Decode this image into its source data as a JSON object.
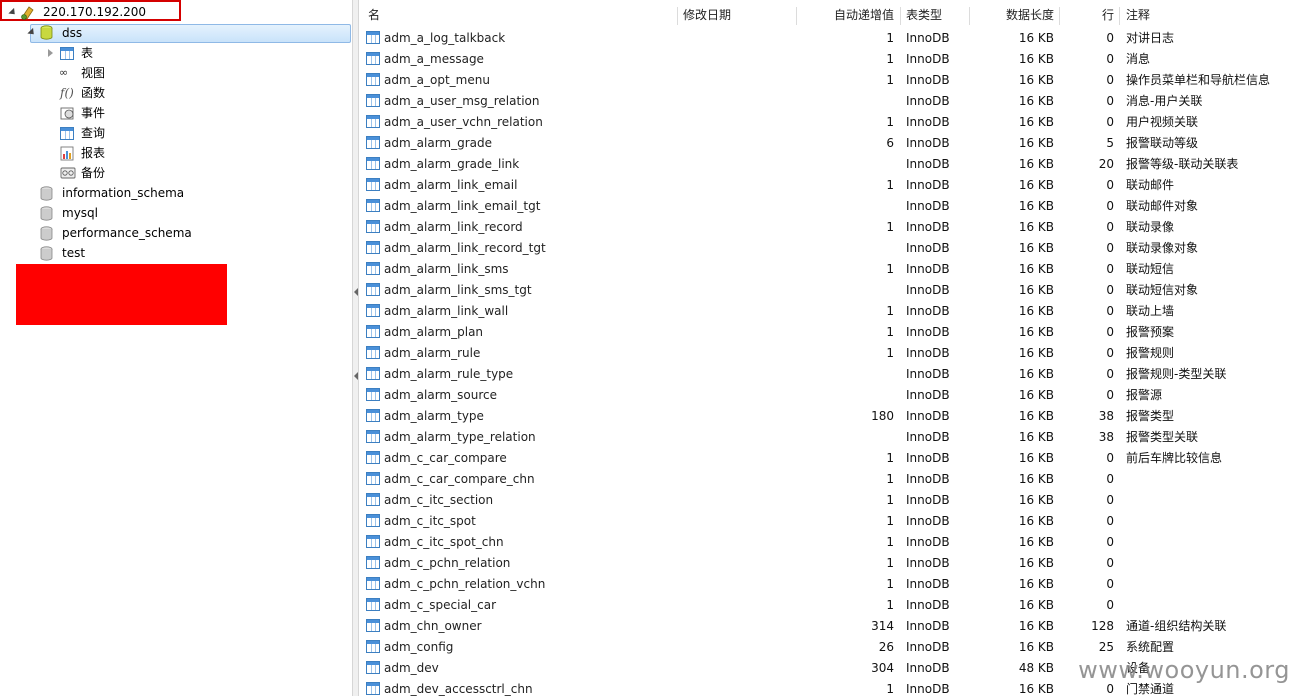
{
  "tree": {
    "connection": "220.170.192.200",
    "database": "dss",
    "children": [
      "表",
      "视图",
      "函数",
      "事件",
      "查询",
      "报表",
      "备份"
    ],
    "other_databases": [
      "information_schema",
      "mysql",
      "performance_schema",
      "test"
    ]
  },
  "columns": [
    "名",
    "修改日期",
    "自动递增值",
    "表类型",
    "数据长度",
    "行",
    "注释"
  ],
  "rows": [
    {
      "name": "adm_a_log_talkback",
      "auto": "1",
      "type": "InnoDB",
      "len": "16 KB",
      "rows": "0",
      "comment": "对讲日志"
    },
    {
      "name": "adm_a_message",
      "auto": "1",
      "type": "InnoDB",
      "len": "16 KB",
      "rows": "0",
      "comment": "消息"
    },
    {
      "name": "adm_a_opt_menu",
      "auto": "1",
      "type": "InnoDB",
      "len": "16 KB",
      "rows": "0",
      "comment": "操作员菜单栏和导航栏信息"
    },
    {
      "name": "adm_a_user_msg_relation",
      "auto": "",
      "type": "InnoDB",
      "len": "16 KB",
      "rows": "0",
      "comment": "消息-用户关联"
    },
    {
      "name": "adm_a_user_vchn_relation",
      "auto": "1",
      "type": "InnoDB",
      "len": "16 KB",
      "rows": "0",
      "comment": "用户视频关联"
    },
    {
      "name": "adm_alarm_grade",
      "auto": "6",
      "type": "InnoDB",
      "len": "16 KB",
      "rows": "5",
      "comment": "报警联动等级"
    },
    {
      "name": "adm_alarm_grade_link",
      "auto": "",
      "type": "InnoDB",
      "len": "16 KB",
      "rows": "20",
      "comment": "报警等级-联动关联表"
    },
    {
      "name": "adm_alarm_link_email",
      "auto": "1",
      "type": "InnoDB",
      "len": "16 KB",
      "rows": "0",
      "comment": "联动邮件"
    },
    {
      "name": "adm_alarm_link_email_tgt",
      "auto": "",
      "type": "InnoDB",
      "len": "16 KB",
      "rows": "0",
      "comment": "联动邮件对象"
    },
    {
      "name": "adm_alarm_link_record",
      "auto": "1",
      "type": "InnoDB",
      "len": "16 KB",
      "rows": "0",
      "comment": "联动录像"
    },
    {
      "name": "adm_alarm_link_record_tgt",
      "auto": "",
      "type": "InnoDB",
      "len": "16 KB",
      "rows": "0",
      "comment": "联动录像对象"
    },
    {
      "name": "adm_alarm_link_sms",
      "auto": "1",
      "type": "InnoDB",
      "len": "16 KB",
      "rows": "0",
      "comment": "联动短信"
    },
    {
      "name": "adm_alarm_link_sms_tgt",
      "auto": "",
      "type": "InnoDB",
      "len": "16 KB",
      "rows": "0",
      "comment": "联动短信对象"
    },
    {
      "name": "adm_alarm_link_wall",
      "auto": "1",
      "type": "InnoDB",
      "len": "16 KB",
      "rows": "0",
      "comment": "联动上墙"
    },
    {
      "name": "adm_alarm_plan",
      "auto": "1",
      "type": "InnoDB",
      "len": "16 KB",
      "rows": "0",
      "comment": "报警预案"
    },
    {
      "name": "adm_alarm_rule",
      "auto": "1",
      "type": "InnoDB",
      "len": "16 KB",
      "rows": "0",
      "comment": "报警规则"
    },
    {
      "name": "adm_alarm_rule_type",
      "auto": "",
      "type": "InnoDB",
      "len": "16 KB",
      "rows": "0",
      "comment": "报警规则-类型关联"
    },
    {
      "name": "adm_alarm_source",
      "auto": "",
      "type": "InnoDB",
      "len": "16 KB",
      "rows": "0",
      "comment": "报警源"
    },
    {
      "name": "adm_alarm_type",
      "auto": "180",
      "type": "InnoDB",
      "len": "16 KB",
      "rows": "38",
      "comment": "报警类型"
    },
    {
      "name": "adm_alarm_type_relation",
      "auto": "",
      "type": "InnoDB",
      "len": "16 KB",
      "rows": "38",
      "comment": "报警类型关联"
    },
    {
      "name": "adm_c_car_compare",
      "auto": "1",
      "type": "InnoDB",
      "len": "16 KB",
      "rows": "0",
      "comment": "前后车牌比较信息"
    },
    {
      "name": "adm_c_car_compare_chn",
      "auto": "1",
      "type": "InnoDB",
      "len": "16 KB",
      "rows": "0",
      "comment": ""
    },
    {
      "name": "adm_c_itc_section",
      "auto": "1",
      "type": "InnoDB",
      "len": "16 KB",
      "rows": "0",
      "comment": ""
    },
    {
      "name": "adm_c_itc_spot",
      "auto": "1",
      "type": "InnoDB",
      "len": "16 KB",
      "rows": "0",
      "comment": ""
    },
    {
      "name": "adm_c_itc_spot_chn",
      "auto": "1",
      "type": "InnoDB",
      "len": "16 KB",
      "rows": "0",
      "comment": ""
    },
    {
      "name": "adm_c_pchn_relation",
      "auto": "1",
      "type": "InnoDB",
      "len": "16 KB",
      "rows": "0",
      "comment": ""
    },
    {
      "name": "adm_c_pchn_relation_vchn",
      "auto": "1",
      "type": "InnoDB",
      "len": "16 KB",
      "rows": "0",
      "comment": ""
    },
    {
      "name": "adm_c_special_car",
      "auto": "1",
      "type": "InnoDB",
      "len": "16 KB",
      "rows": "0",
      "comment": ""
    },
    {
      "name": "adm_chn_owner",
      "auto": "314",
      "type": "InnoDB",
      "len": "16 KB",
      "rows": "128",
      "comment": "通道-组织结构关联"
    },
    {
      "name": "adm_config",
      "auto": "26",
      "type": "InnoDB",
      "len": "16 KB",
      "rows": "25",
      "comment": "系统配置"
    },
    {
      "name": "adm_dev",
      "auto": "304",
      "type": "InnoDB",
      "len": "48 KB",
      "rows": "",
      "comment": "设备"
    },
    {
      "name": "adm_dev_accessctrl_chn",
      "auto": "1",
      "type": "InnoDB",
      "len": "16 KB",
      "rows": "0",
      "comment": "门禁通道"
    }
  ],
  "watermark": "www.wooyun.org",
  "colors": {
    "selection": "#c9e3fa",
    "highlight_box": "#d40000",
    "redaction": "#ff0000",
    "table_icon": "#4a90d9"
  }
}
